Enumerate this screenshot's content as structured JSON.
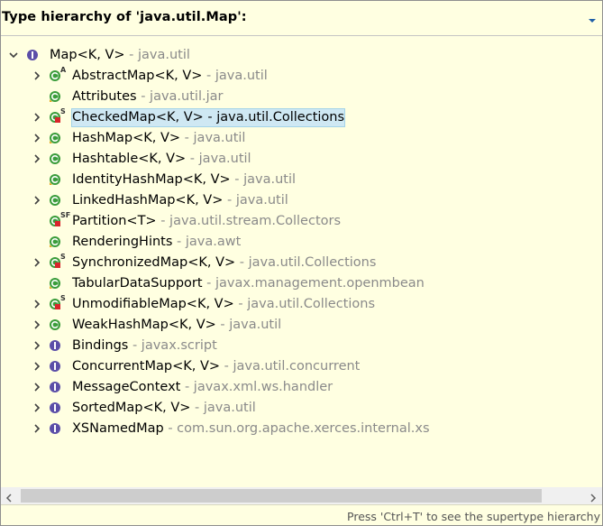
{
  "header": {
    "title": "Type hierarchy of 'java.util.Map':"
  },
  "tree": {
    "root": {
      "name": "Map<K, V>",
      "package": "java.util",
      "kind": "interface",
      "expanded": true
    },
    "items": [
      {
        "name": "AbstractMap<K, V>",
        "package": "java.util",
        "kind": "class-abstract",
        "expandable": true
      },
      {
        "name": "Attributes",
        "package": "java.util.jar",
        "kind": "class-public",
        "expandable": false
      },
      {
        "name": "CheckedMap<K, V>",
        "package": "java.util.Collections",
        "kind": "class-private-static",
        "expandable": true,
        "selected": true
      },
      {
        "name": "HashMap<K, V>",
        "package": "java.util",
        "kind": "class-public",
        "expandable": true
      },
      {
        "name": "Hashtable<K, V>",
        "package": "java.util",
        "kind": "class-public-solid",
        "expandable": true
      },
      {
        "name": "IdentityHashMap<K, V>",
        "package": "java.util",
        "kind": "class-public",
        "expandable": false
      },
      {
        "name": "LinkedHashMap<K, V>",
        "package": "java.util",
        "kind": "class-public-solid",
        "expandable": true
      },
      {
        "name": "Partition<T>",
        "package": "java.util.stream.Collectors",
        "kind": "class-private-static-final",
        "expandable": false
      },
      {
        "name": "RenderingHints",
        "package": "java.awt",
        "kind": "class-public",
        "expandable": false
      },
      {
        "name": "SynchronizedMap<K, V>",
        "package": "java.util.Collections",
        "kind": "class-private-static",
        "expandable": true
      },
      {
        "name": "TabularDataSupport",
        "package": "javax.management.openmbean",
        "kind": "class-public",
        "expandable": false
      },
      {
        "name": "UnmodifiableMap<K, V>",
        "package": "java.util.Collections",
        "kind": "class-private-static",
        "expandable": true
      },
      {
        "name": "WeakHashMap<K, V>",
        "package": "java.util",
        "kind": "class-public-solid",
        "expandable": true
      },
      {
        "name": "Bindings",
        "package": "javax.script",
        "kind": "interface",
        "expandable": true
      },
      {
        "name": "ConcurrentMap<K, V>",
        "package": "java.util.concurrent",
        "kind": "interface",
        "expandable": true
      },
      {
        "name": "MessageContext",
        "package": "javax.xml.ws.handler",
        "kind": "interface",
        "expandable": true
      },
      {
        "name": "SortedMap<K, V>",
        "package": "java.util",
        "kind": "interface",
        "expandable": true
      },
      {
        "name": "XSNamedMap",
        "package": "com.sun.org.apache.xerces.internal.xs",
        "kind": "interface",
        "expandable": true
      }
    ]
  },
  "footer": {
    "hint": "Press 'Ctrl+T' to see the supertype hierarchy"
  },
  "colors": {
    "background": "#ffffe1",
    "selection": "#cfe8f3",
    "package_text": "#8a8a8a",
    "class_icon": "#3a9c3a",
    "interface_icon": "#5b4ea8"
  }
}
